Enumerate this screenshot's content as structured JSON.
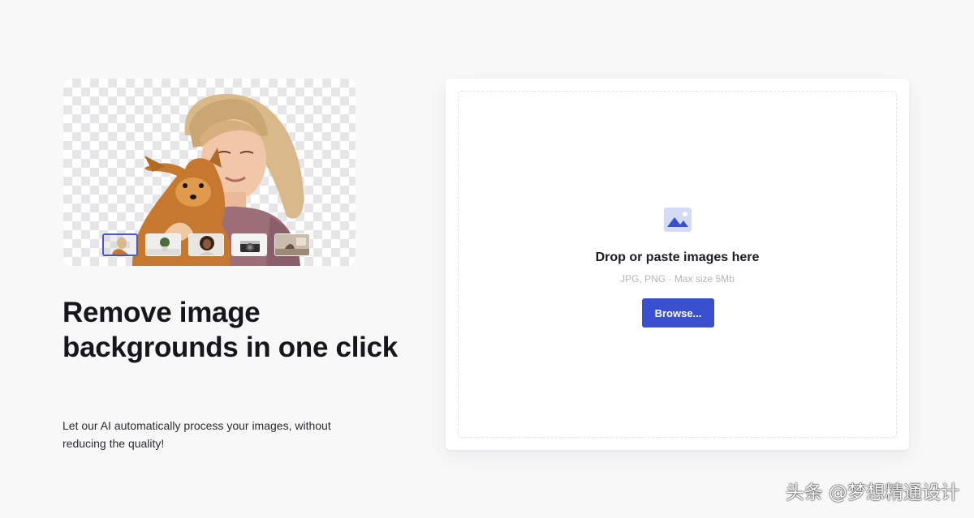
{
  "hero": {
    "thumbnails": [
      {
        "name": "woman-with-dog",
        "selected": true
      },
      {
        "name": "plant",
        "selected": false
      },
      {
        "name": "portrait",
        "selected": false
      },
      {
        "name": "camera",
        "selected": false
      },
      {
        "name": "room",
        "selected": false
      }
    ]
  },
  "headline": "Remove image backgrounds in one click",
  "subtext": "Let our AI automatically process your images, without reducing the quality!",
  "upload": {
    "icon": "image-icon",
    "title": "Drop or paste images here",
    "hint": "JPG, PNG · Max size 5Mb",
    "browse_label": "Browse..."
  },
  "watermark": "头条 @梦想精通设计",
  "colors": {
    "accent": "#3a4fcf",
    "background": "#f8f8f9",
    "text": "#17171b",
    "hint": "#b4b4bc"
  }
}
